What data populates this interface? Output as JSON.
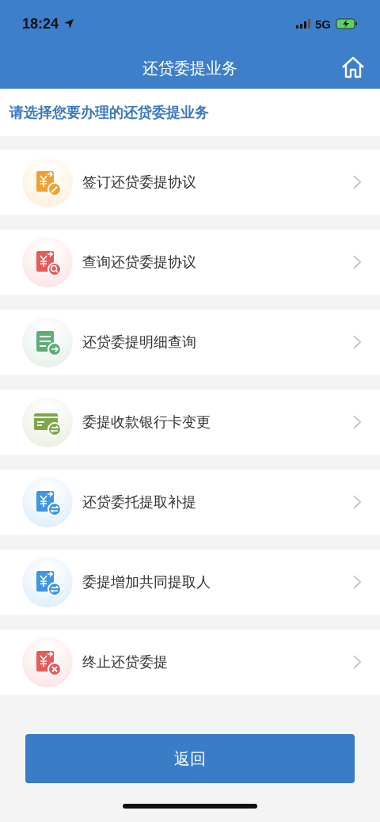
{
  "status_bar": {
    "time": "18:24",
    "network": "5G"
  },
  "header": {
    "title": "还贷委提业务"
  },
  "prompt": "请选择您要办理的还贷委提业务",
  "items": [
    {
      "label": "签订还贷委提协议",
      "kind": "sign",
      "color": "#f0a030"
    },
    {
      "label": "查询还贷委提协议",
      "kind": "query",
      "color": "#e65a5a"
    },
    {
      "label": "还贷委提明细查询",
      "kind": "detail",
      "color": "#5fae78"
    },
    {
      "label": "委提收款银行卡变更",
      "kind": "card",
      "color": "#7fa64a"
    },
    {
      "label": "还贷委托提取补提",
      "kind": "transfer",
      "color": "#3f95e0"
    },
    {
      "label": "委提增加共同提取人",
      "kind": "transfer",
      "color": "#3f95e0"
    },
    {
      "label": "终止还贷委提",
      "kind": "terminate",
      "color": "#e65a5a"
    }
  ],
  "back_button": "返回"
}
